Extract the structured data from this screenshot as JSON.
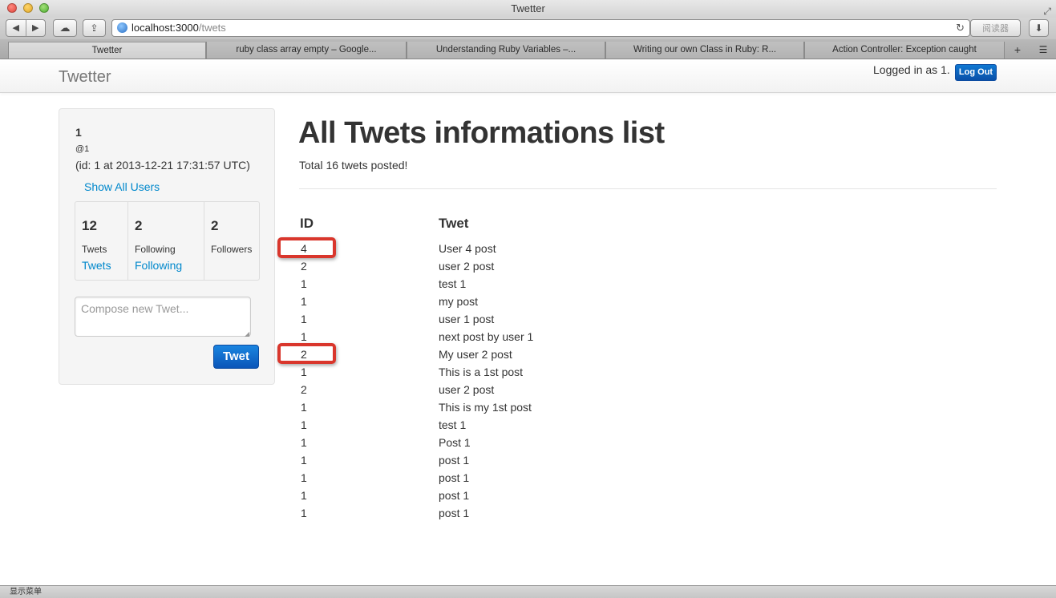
{
  "window": {
    "title": "Twetter"
  },
  "toolbar": {
    "back_glyph": "◀",
    "forward_glyph": "▶",
    "cloud_glyph": "☁",
    "share_glyph": "⇪",
    "url_host": "localhost:3000",
    "url_path": "/twets",
    "reload_glyph": "↻",
    "reader_label": "阅读器",
    "download_glyph": "⬇"
  },
  "tabs": [
    {
      "label": "Twetter"
    },
    {
      "label": "ruby class array empty – Google..."
    },
    {
      "label": "Understanding Ruby Variables –..."
    },
    {
      "label": "Writing our own Class in Ruby: R..."
    },
    {
      "label": "Action Controller: Exception caught"
    }
  ],
  "navbar": {
    "brand": "Twetter",
    "logged_in_text": "Logged in as 1.",
    "logout_label": "Log Out"
  },
  "sidebar": {
    "name": "1",
    "handle": "@1",
    "joined": "(id: 1 at 2013-12-21 17:31:57 UTC)",
    "show_all_users": "Show All Users",
    "stats": [
      {
        "count": "12",
        "label": "Twets",
        "link": "Twets"
      },
      {
        "count": "2",
        "label": "Following",
        "link": "Following"
      },
      {
        "count": "2",
        "label": "Followers",
        "link": ""
      }
    ],
    "compose_placeholder": "Compose new Twet...",
    "tweet_button": "Twet"
  },
  "main": {
    "title": "All Twets informations list",
    "total_text": "Total 16 twets posted!",
    "columns": [
      "ID",
      "Twet"
    ],
    "rows": [
      {
        "id": "4",
        "twet": "User 4 post",
        "highlighted": true
      },
      {
        "id": "2",
        "twet": "user 2 post",
        "highlighted": false
      },
      {
        "id": "1",
        "twet": "test 1",
        "highlighted": false
      },
      {
        "id": "1",
        "twet": "my post",
        "highlighted": false
      },
      {
        "id": "1",
        "twet": "user 1 post",
        "highlighted": false
      },
      {
        "id": "1",
        "twet": "next post by user 1",
        "highlighted": false
      },
      {
        "id": "2",
        "twet": "My user 2 post",
        "highlighted": true
      },
      {
        "id": "1",
        "twet": "This is a 1st post",
        "highlighted": false
      },
      {
        "id": "2",
        "twet": "user 2 post",
        "highlighted": false
      },
      {
        "id": "1",
        "twet": "This is my 1st post",
        "highlighted": false
      },
      {
        "id": "1",
        "twet": "test 1",
        "highlighted": false
      },
      {
        "id": "1",
        "twet": "Post 1",
        "highlighted": false
      },
      {
        "id": "1",
        "twet": "post 1",
        "highlighted": false
      },
      {
        "id": "1",
        "twet": "post 1",
        "highlighted": false
      },
      {
        "id": "1",
        "twet": "post 1",
        "highlighted": false
      },
      {
        "id": "1",
        "twet": "post 1",
        "highlighted": false
      }
    ],
    "highlight_color": "#d9362c"
  },
  "statusbar": {
    "text": "显示菜单"
  }
}
